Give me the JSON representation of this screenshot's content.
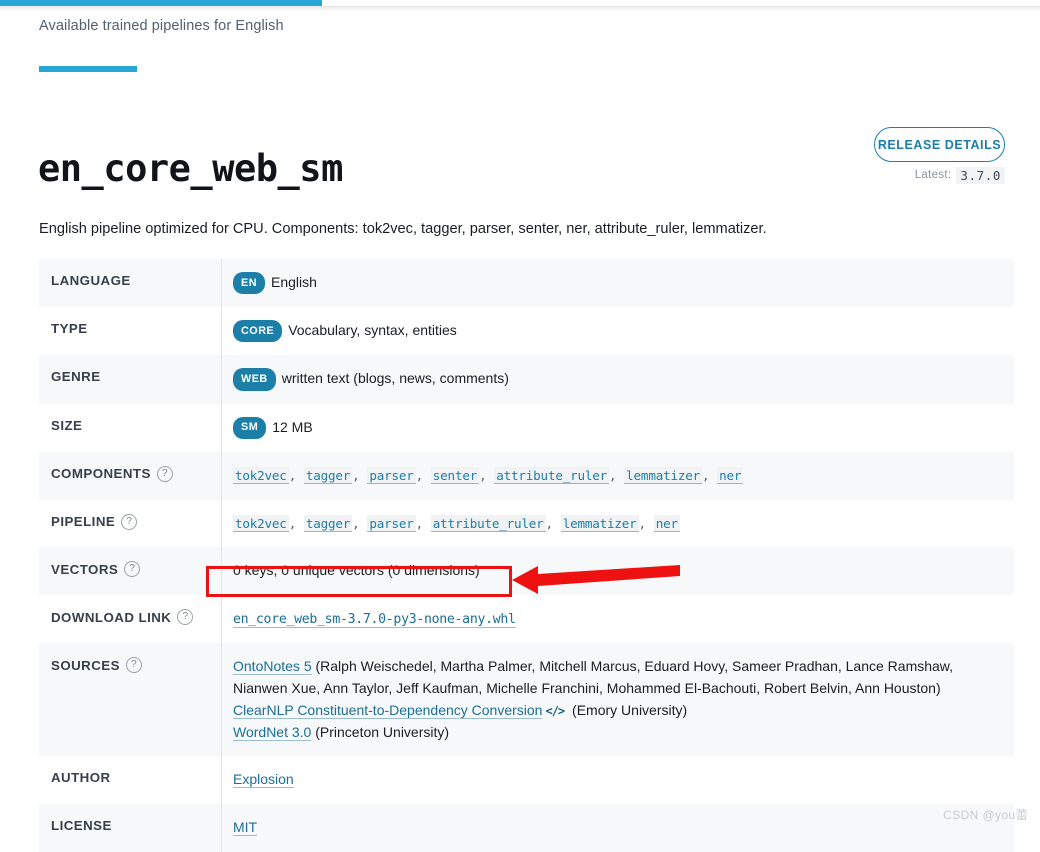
{
  "browser": {
    "loading_progress_percent": 31,
    "accent_color": "#29a5d6"
  },
  "header": {
    "kicker": "Available trained pipelines for English",
    "title": "en_core_web_sm",
    "release_button_label": "RELEASE DETAILS",
    "latest_label": "Latest:",
    "latest_version": "3.7.0"
  },
  "description": "English pipeline optimized for CPU. Components: tok2vec, tagger, parser, senter, ner, attribute_ruler, lemmatizer.",
  "table": {
    "rows": [
      {
        "key": "LANGUAGE",
        "badge": "EN",
        "value": "English"
      },
      {
        "key": "TYPE",
        "badge": "CORE",
        "value": "Vocabulary, syntax, entities"
      },
      {
        "key": "GENRE",
        "badge": "WEB",
        "value": "written text (blogs, news, comments)"
      },
      {
        "key": "SIZE",
        "badge": "SM",
        "value": "12 MB"
      },
      {
        "key": "COMPONENTS",
        "help": "?",
        "chips": [
          "tok2vec",
          "tagger",
          "parser",
          "senter",
          "attribute_ruler",
          "lemmatizer",
          "ner"
        ]
      },
      {
        "key": "PIPELINE",
        "help": "?",
        "chips": [
          "tok2vec",
          "tagger",
          "parser",
          "attribute_ruler",
          "lemmatizer",
          "ner"
        ]
      },
      {
        "key": "VECTORS",
        "help": "?",
        "value": "0 keys, 0 unique vectors (0 dimensions)"
      },
      {
        "key": "DOWNLOAD LINK",
        "help": "?",
        "download_link": "en_core_web_sm-3.7.0-py3-none-any.whl"
      },
      {
        "key": "SOURCES",
        "help": "?",
        "sources": [
          {
            "link": "OntoNotes 5",
            "code_icon": false,
            "text": " (Ralph Weischedel, Martha Palmer, Mitchell Marcus, Eduard Hovy, Sameer Pradhan, Lance Ramshaw, Nianwen Xue, Ann Taylor, Jeff Kaufman, Michelle Franchini, Mohammed El-Bachouti, Robert Belvin, Ann Houston)"
          },
          {
            "link": "ClearNLP Constituent-to-Dependency Conversion",
            "code_icon": true,
            "text": "  (Emory University)"
          },
          {
            "link": "WordNet 3.0",
            "code_icon": false,
            "text": " (Princeton University)"
          }
        ]
      },
      {
        "key": "AUTHOR",
        "link": "Explosion"
      },
      {
        "key": "LICENSE",
        "link": "MIT"
      }
    ]
  },
  "annotations": {
    "highlight_box_color": "#ee1111",
    "arrow_color": "#ee1111",
    "arrow_points_to": "download-link"
  },
  "watermark": "CSDN @you蕾"
}
